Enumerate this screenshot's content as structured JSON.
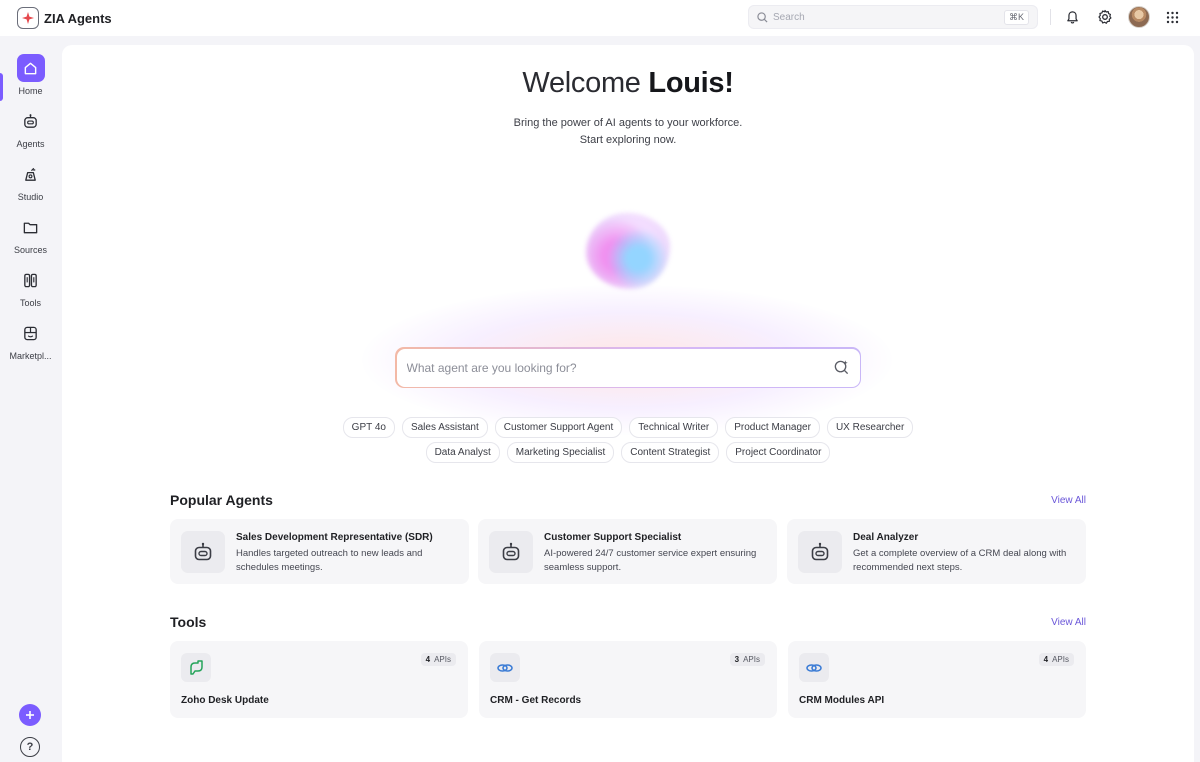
{
  "app": {
    "name": "ZIA Agents"
  },
  "header": {
    "search_placeholder": "Search",
    "search_shortcut": "⌘K"
  },
  "sidebar": {
    "items": [
      {
        "label": "Home",
        "icon": "home-icon",
        "active": true
      },
      {
        "label": "Agents",
        "icon": "robot-icon",
        "active": false
      },
      {
        "label": "Studio",
        "icon": "studio-icon",
        "active": false
      },
      {
        "label": "Sources",
        "icon": "folder-icon",
        "active": false
      },
      {
        "label": "Tools",
        "icon": "tools-icon",
        "active": false
      },
      {
        "label": "Marketpl...",
        "icon": "marketplace-icon",
        "active": false
      }
    ]
  },
  "main": {
    "welcome_prefix": "Welcome",
    "user_name": "Louis!",
    "subtitle_line1": "Bring the power of AI agents to your workforce.",
    "subtitle_line2": "Start exploring now.",
    "agent_search_placeholder": "What agent are you looking for?",
    "chips_row1": [
      "GPT 4o",
      "Sales Assistant",
      "Customer Support Agent",
      "Technical Writer",
      "Product Manager",
      "UX Researcher"
    ],
    "chips_row2": [
      "Data Analyst",
      "Marketing Specialist",
      "Content Strategist",
      "Project Coordinator"
    ]
  },
  "popular_agents": {
    "title": "Popular Agents",
    "view_all": "View All",
    "items": [
      {
        "title": "Sales Development Representative (SDR)",
        "description": "Handles targeted outreach to new leads and schedules meetings."
      },
      {
        "title": "Customer Support Specialist",
        "description": "AI-powered 24/7 customer service expert ensuring seamless support."
      },
      {
        "title": "Deal Analyzer",
        "description": "Get a complete overview of a CRM deal along with recommended next steps."
      }
    ]
  },
  "tools": {
    "title": "Tools",
    "view_all": "View All",
    "items": [
      {
        "title": "Zoho Desk Update",
        "api_count": "4",
        "api_label": "APIs",
        "icon": "zoho-desk-icon"
      },
      {
        "title": "CRM - Get Records",
        "api_count": "3",
        "api_label": "APIs",
        "icon": "crm-link-icon"
      },
      {
        "title": "CRM Modules API",
        "api_count": "4",
        "api_label": "APIs",
        "icon": "crm-link-icon"
      }
    ]
  },
  "colors": {
    "accent": "#7b5cff",
    "link": "#6b57d9",
    "card_bg": "#f6f6f8"
  }
}
